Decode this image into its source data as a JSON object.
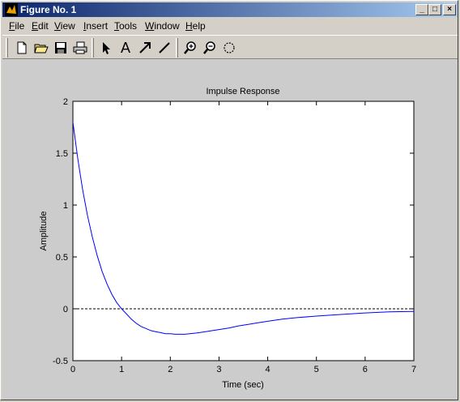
{
  "window": {
    "title": "Figure No. 1",
    "buttons": [
      "_",
      "□",
      "×"
    ]
  },
  "menu": [
    {
      "label": "File",
      "u": "F",
      "rest": "ile"
    },
    {
      "label": "Edit",
      "u": "E",
      "rest": "dit"
    },
    {
      "label": "View",
      "u": "V",
      "rest": "iew"
    },
    {
      "label": "Insert",
      "u": "I",
      "rest": "nsert"
    },
    {
      "label": "Tools",
      "u": "T",
      "rest": "ools"
    },
    {
      "label": "Window",
      "u": "W",
      "rest": "indow"
    },
    {
      "label": "Help",
      "u": "H",
      "rest": "elp"
    }
  ],
  "toolbar": {
    "tools": [
      "new-file-icon",
      "open-folder-icon",
      "save-icon",
      "print-icon",
      "arrow-select-icon",
      "text-icon",
      "arrow-draw-icon",
      "line-draw-icon",
      "zoom-in-icon",
      "zoom-out-icon",
      "rotate-icon"
    ],
    "text_tool_label": "A"
  },
  "colors": {
    "line": "#0000ff",
    "plot_bg": "#ffffff",
    "figure_bg": "#cccccc"
  },
  "chart_data": {
    "type": "line",
    "title": "Impulse Response",
    "xlabel": "Time (sec)",
    "ylabel": "Amplitude",
    "xlim": [
      0,
      7
    ],
    "ylim": [
      -0.5,
      2
    ],
    "xticks": [
      0,
      1,
      2,
      3,
      4,
      5,
      6,
      7
    ],
    "yticks": [
      -0.5,
      0,
      0.5,
      1,
      1.5,
      2
    ],
    "xtick_labels": [
      "0",
      "1",
      "2",
      "3",
      "4",
      "5",
      "6",
      "7"
    ],
    "ytick_labels": [
      "-0.5",
      "0",
      "0.5",
      "1",
      "1.5",
      "2"
    ],
    "grid": false,
    "reference_line": {
      "y": 0,
      "style": "dashed"
    },
    "series": [
      {
        "x": [
          0,
          0.1,
          0.2,
          0.3,
          0.4,
          0.5,
          0.6,
          0.7,
          0.8,
          0.9,
          1.0,
          1.1,
          1.2,
          1.3,
          1.4,
          1.5,
          1.6,
          1.7,
          1.8,
          1.9,
          2.0,
          2.1,
          2.2,
          2.3,
          2.4,
          2.5,
          2.6,
          2.8,
          3.0,
          3.2,
          3.4,
          3.6,
          3.8,
          4.0,
          4.3,
          4.6,
          5.0,
          5.5,
          6.0,
          6.5,
          7.0
        ],
        "values": [
          1.8,
          1.45,
          1.15,
          0.9,
          0.69,
          0.51,
          0.36,
          0.24,
          0.14,
          0.06,
          0.0,
          -0.05,
          -0.1,
          -0.14,
          -0.17,
          -0.19,
          -0.21,
          -0.22,
          -0.23,
          -0.24,
          -0.24,
          -0.245,
          -0.245,
          -0.245,
          -0.24,
          -0.235,
          -0.23,
          -0.215,
          -0.2,
          -0.185,
          -0.165,
          -0.15,
          -0.135,
          -0.12,
          -0.1,
          -0.085,
          -0.07,
          -0.055,
          -0.04,
          -0.03,
          -0.025
        ]
      }
    ]
  }
}
